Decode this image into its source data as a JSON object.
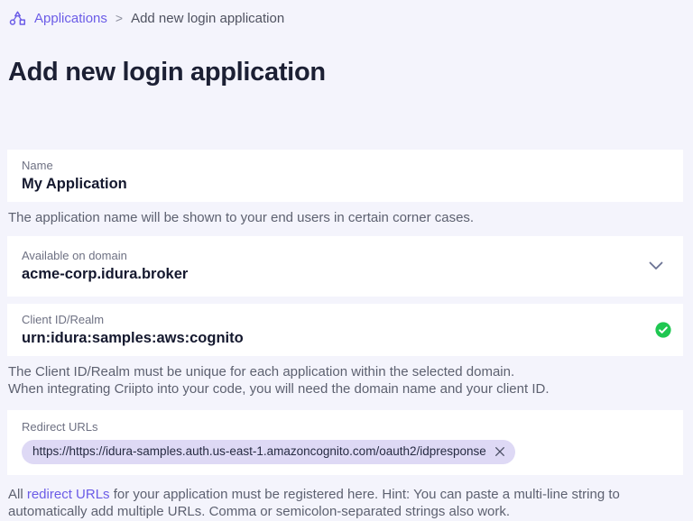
{
  "breadcrumb": {
    "root_label": "Applications",
    "separator": ">",
    "current_label": "Add new login application"
  },
  "page_title": "Add new login application",
  "form": {
    "name": {
      "label": "Name",
      "value": "My Application",
      "helper": "The application name will be shown to your end users in certain corner cases."
    },
    "domain": {
      "label": "Available on domain",
      "value": "acme-corp.idura.broker"
    },
    "client_id": {
      "label": "Client ID/Realm",
      "value": "urn:idura:samples:aws:cognito",
      "helper_line1": "The Client ID/Realm must be unique for each application within the selected domain.",
      "helper_line2": "When integrating Criipto into your code, you will need the domain name and your client ID."
    },
    "redirect_urls": {
      "label": "Redirect URLs",
      "chips": [
        {
          "url": "https://https://idura-samples.auth.us-east-1.amazoncognito.com/oauth2/idpresponse"
        }
      ],
      "helper_prefix": "All ",
      "helper_link_text": "redirect URLs",
      "helper_suffix": " for your application must be registered here. Hint: You can paste a multi-line string to automatically add multiple URLs. Comma or semicolon-separated strings also work."
    }
  },
  "colors": {
    "accent_purple": "#6b5ce7",
    "success_green": "#1fc751",
    "chip_background": "#ded9f5",
    "page_background": "#f4f4fc"
  }
}
